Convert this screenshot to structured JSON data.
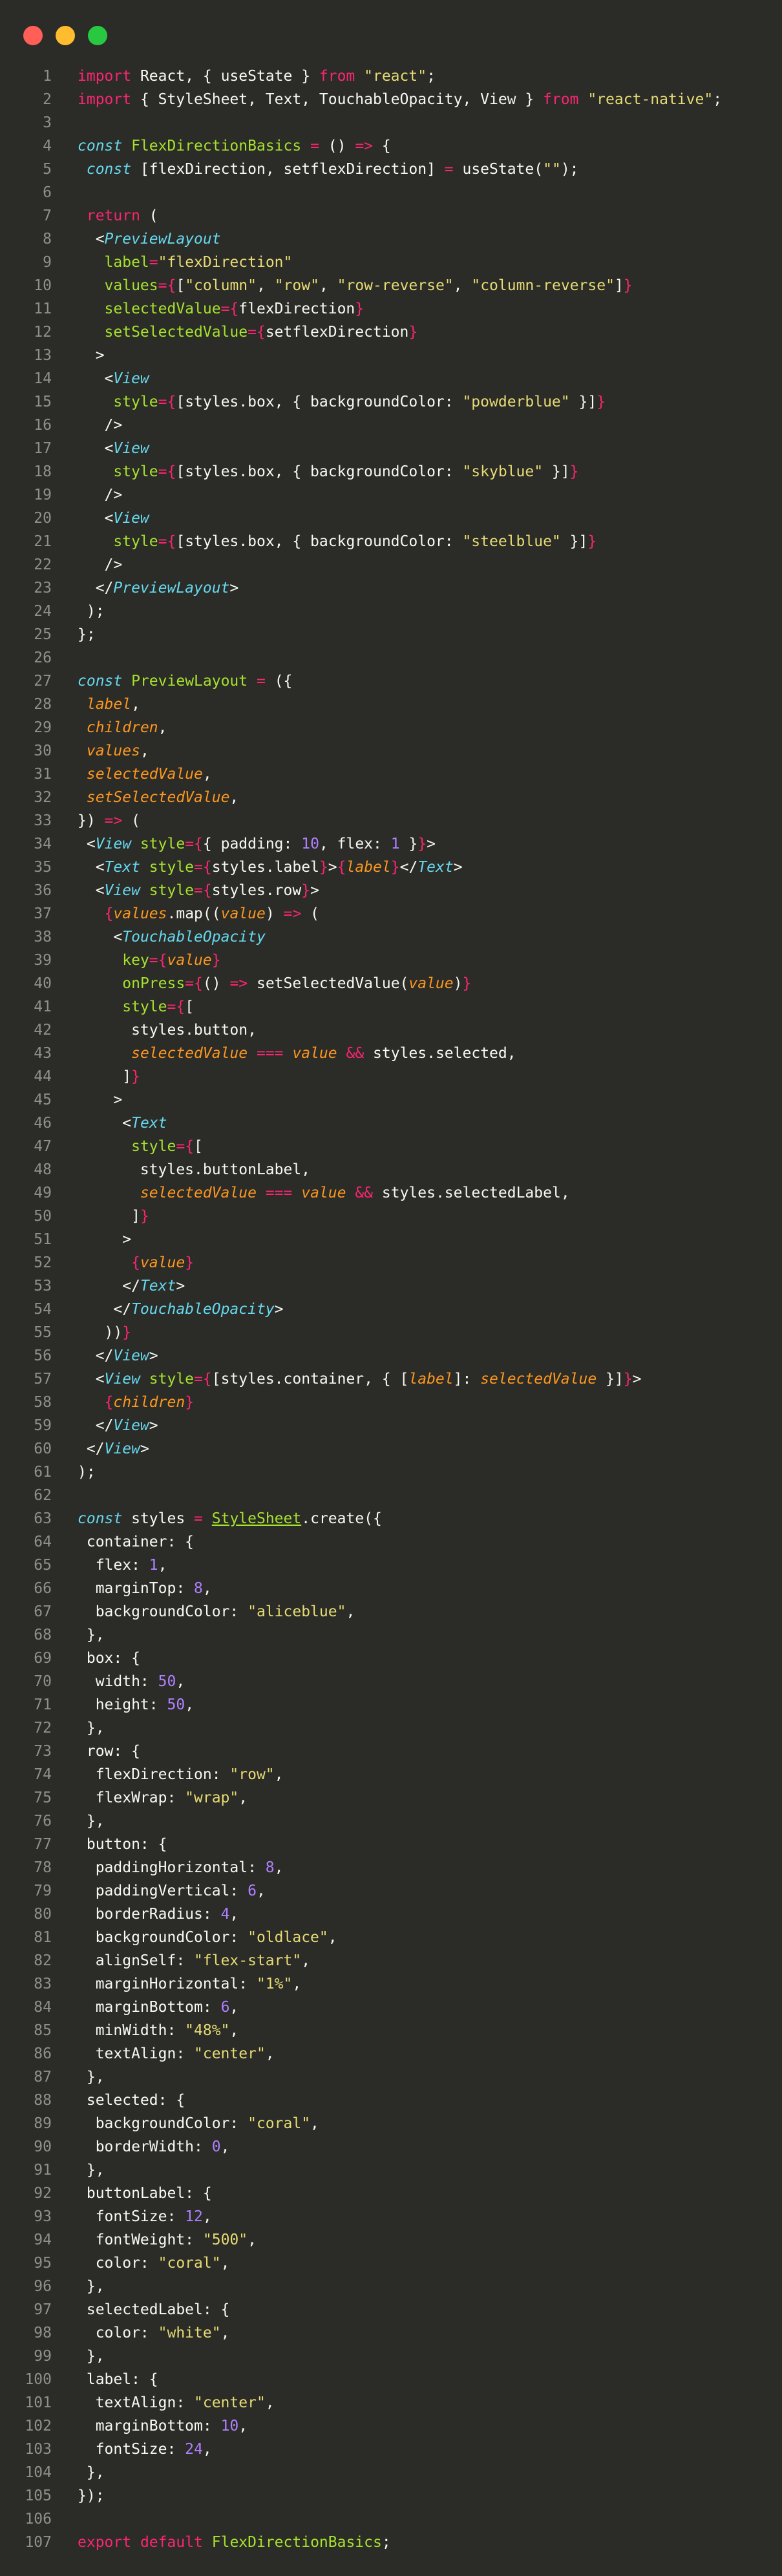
{
  "window": {
    "buttons": [
      {
        "name": "close",
        "color": "#ff5f57"
      },
      {
        "name": "minimize",
        "color": "#febc2e"
      },
      {
        "name": "maximize",
        "color": "#28c840"
      }
    ]
  },
  "theme": {
    "background": "#2b2b27",
    "keyword": "#f92672",
    "string": "#e6db74",
    "number": "#ae81ff",
    "component": "#66d9ef",
    "function": "#a6e22e",
    "param": "#fd971f"
  },
  "lines": [
    [
      [
        "k",
        "import"
      ],
      [
        "",
        "  React, { useState } "
      ],
      [
        "k",
        "from"
      ],
      [
        "",
        "  "
      ],
      [
        "s",
        "\"react\""
      ],
      [
        "",
        ";"
      ]
    ],
    [
      [
        "k",
        "import"
      ],
      [
        "",
        "  { StyleSheet, Text, TouchableOpacity, View } "
      ],
      [
        "k",
        "from"
      ],
      [
        "",
        "  "
      ],
      [
        "s",
        "\"react-native\""
      ],
      [
        "",
        ";"
      ]
    ],
    [],
    [
      [
        "c",
        "const"
      ],
      [
        "",
        "  "
      ],
      [
        "f",
        "FlexDirectionBasics"
      ],
      [
        "",
        "  "
      ],
      [
        "k",
        "="
      ],
      [
        "",
        "  () "
      ],
      [
        "k",
        "=>"
      ],
      [
        "",
        "  {"
      ]
    ],
    [
      [
        "",
        "  "
      ],
      [
        "c",
        "const"
      ],
      [
        "",
        "  [flexDirection, setflexDirection] "
      ],
      [
        "k",
        "="
      ],
      [
        "",
        "  useState("
      ],
      [
        "s",
        "\"\""
      ],
      [
        "",
        ");"
      ]
    ],
    [],
    [
      [
        "",
        "  "
      ],
      [
        "k",
        "return"
      ],
      [
        "",
        "  ("
      ]
    ],
    [
      [
        "",
        "    <"
      ],
      [
        "c",
        "PreviewLayout"
      ]
    ],
    [
      [
        "",
        "      "
      ],
      [
        "f",
        "label"
      ],
      [
        "k",
        "="
      ],
      [
        "s",
        "\"flexDirection\""
      ]
    ],
    [
      [
        "",
        "      "
      ],
      [
        "f",
        "values"
      ],
      [
        "k",
        "={"
      ],
      [
        "",
        "["
      ],
      [
        "s",
        "\"column\""
      ],
      [
        "",
        ", "
      ],
      [
        "s",
        "\"row\""
      ],
      [
        "",
        ", "
      ],
      [
        "s",
        "\"row-reverse\""
      ],
      [
        "",
        ", "
      ],
      [
        "s",
        "\"column-reverse\""
      ],
      [
        "",
        "]"
      ],
      [
        "k",
        "}"
      ]
    ],
    [
      [
        "",
        "      "
      ],
      [
        "f",
        "selectedValue"
      ],
      [
        "k",
        "={"
      ],
      [
        "",
        "flexDirection"
      ],
      [
        "k",
        "}"
      ]
    ],
    [
      [
        "",
        "      "
      ],
      [
        "f",
        "setSelectedValue"
      ],
      [
        "k",
        "={"
      ],
      [
        "",
        "setflexDirection"
      ],
      [
        "k",
        "}"
      ]
    ],
    [
      [
        "",
        "    >"
      ]
    ],
    [
      [
        "",
        "      <"
      ],
      [
        "c",
        "View"
      ]
    ],
    [
      [
        "",
        "        "
      ],
      [
        "f",
        "style"
      ],
      [
        "k",
        "={"
      ],
      [
        "",
        "[styles.box, { backgroundColor: "
      ],
      [
        "s",
        "\"powderblue\""
      ],
      [
        "",
        "  }]"
      ],
      [
        "k",
        "}"
      ]
    ],
    [
      [
        "",
        "      />"
      ]
    ],
    [
      [
        "",
        "      <"
      ],
      [
        "c",
        "View"
      ]
    ],
    [
      [
        "",
        "        "
      ],
      [
        "f",
        "style"
      ],
      [
        "k",
        "={"
      ],
      [
        "",
        "[styles.box, { backgroundColor: "
      ],
      [
        "s",
        "\"skyblue\""
      ],
      [
        "",
        "  }]"
      ],
      [
        "k",
        "}"
      ]
    ],
    [
      [
        "",
        "      />"
      ]
    ],
    [
      [
        "",
        "      <"
      ],
      [
        "c",
        "View"
      ]
    ],
    [
      [
        "",
        "        "
      ],
      [
        "f",
        "style"
      ],
      [
        "k",
        "={"
      ],
      [
        "",
        "[styles.box, { backgroundColor: "
      ],
      [
        "s",
        "\"steelblue\""
      ],
      [
        "",
        "  }]"
      ],
      [
        "k",
        "}"
      ]
    ],
    [
      [
        "",
        "      />"
      ]
    ],
    [
      [
        "",
        "    </"
      ],
      [
        "c",
        "PreviewLayout"
      ],
      [
        "",
        ">"
      ]
    ],
    [
      [
        "",
        "  );"
      ]
    ],
    [
      [
        "",
        "};"
      ]
    ],
    [],
    [
      [
        "c",
        "const"
      ],
      [
        "",
        "  "
      ],
      [
        "f",
        "PreviewLayout"
      ],
      [
        "",
        "  "
      ],
      [
        "k",
        "="
      ],
      [
        "",
        "  ({"
      ]
    ],
    [
      [
        "",
        "  "
      ],
      [
        "p",
        "label"
      ],
      [
        "",
        ","
      ]
    ],
    [
      [
        "",
        "  "
      ],
      [
        "p",
        "children"
      ],
      [
        "",
        ","
      ]
    ],
    [
      [
        "",
        "  "
      ],
      [
        "p",
        "values"
      ],
      [
        "",
        ","
      ]
    ],
    [
      [
        "",
        "  "
      ],
      [
        "p",
        "selectedValue"
      ],
      [
        "",
        ","
      ]
    ],
    [
      [
        "",
        "  "
      ],
      [
        "p",
        "setSelectedValue"
      ],
      [
        "",
        ","
      ]
    ],
    [
      [
        "",
        "}) "
      ],
      [
        "k",
        "=>"
      ],
      [
        "",
        "  ("
      ]
    ],
    [
      [
        "",
        "  <"
      ],
      [
        "c",
        "View"
      ],
      [
        "",
        "  "
      ],
      [
        "f",
        "style"
      ],
      [
        "k",
        "={"
      ],
      [
        "",
        "{ padding: "
      ],
      [
        "n",
        "10"
      ],
      [
        "",
        ", flex: "
      ],
      [
        "n",
        "1"
      ],
      [
        "",
        "  }"
      ],
      [
        "k",
        "}"
      ],
      [
        "",
        ">"
      ]
    ],
    [
      [
        "",
        "    <"
      ],
      [
        "c",
        "Text"
      ],
      [
        "",
        "  "
      ],
      [
        "f",
        "style"
      ],
      [
        "k",
        "={"
      ],
      [
        "",
        "styles.label"
      ],
      [
        "k",
        "}"
      ],
      [
        "",
        ">"
      ],
      [
        "k",
        "{"
      ],
      [
        "p",
        "label"
      ],
      [
        "k",
        "}"
      ],
      [
        "",
        "</"
      ],
      [
        "c",
        "Text"
      ],
      [
        "",
        ">"
      ]
    ],
    [
      [
        "",
        "    <"
      ],
      [
        "c",
        "View"
      ],
      [
        "",
        "  "
      ],
      [
        "f",
        "style"
      ],
      [
        "k",
        "={"
      ],
      [
        "",
        "styles.row"
      ],
      [
        "k",
        "}"
      ],
      [
        "",
        ">"
      ]
    ],
    [
      [
        "",
        "      "
      ],
      [
        "k",
        "{"
      ],
      [
        "p",
        "values"
      ],
      [
        "",
        ".map(("
      ],
      [
        "p",
        "value"
      ],
      [
        "",
        ") "
      ],
      [
        "k",
        "=>"
      ],
      [
        "",
        "  ("
      ]
    ],
    [
      [
        "",
        "        <"
      ],
      [
        "c",
        "TouchableOpacity"
      ]
    ],
    [
      [
        "",
        "          "
      ],
      [
        "f",
        "key"
      ],
      [
        "k",
        "={"
      ],
      [
        "p",
        "value"
      ],
      [
        "k",
        "}"
      ]
    ],
    [
      [
        "",
        "          "
      ],
      [
        "f",
        "onPress"
      ],
      [
        "k",
        "={"
      ],
      [
        "",
        "() "
      ],
      [
        "k",
        "=>"
      ],
      [
        "",
        "  setSelectedValue("
      ],
      [
        "p",
        "value"
      ],
      [
        "",
        ")"
      ],
      [
        "k",
        "}"
      ]
    ],
    [
      [
        "",
        "          "
      ],
      [
        "f",
        "style"
      ],
      [
        "k",
        "={"
      ],
      [
        "",
        "["
      ]
    ],
    [
      [
        "",
        "            styles.button,"
      ]
    ],
    [
      [
        "",
        "            "
      ],
      [
        "p",
        "selectedValue"
      ],
      [
        "",
        "  "
      ],
      [
        "k",
        "==="
      ],
      [
        "",
        "  "
      ],
      [
        "p",
        "value"
      ],
      [
        "",
        "  "
      ],
      [
        "k",
        "&&"
      ],
      [
        "",
        "  styles.selected,"
      ]
    ],
    [
      [
        "",
        "          ]"
      ],
      [
        "k",
        "}"
      ]
    ],
    [
      [
        "",
        "        >"
      ]
    ],
    [
      [
        "",
        "          <"
      ],
      [
        "c",
        "Text"
      ]
    ],
    [
      [
        "",
        "            "
      ],
      [
        "f",
        "style"
      ],
      [
        "k",
        "={"
      ],
      [
        "",
        "["
      ]
    ],
    [
      [
        "",
        "              styles.buttonLabel,"
      ]
    ],
    [
      [
        "",
        "              "
      ],
      [
        "p",
        "selectedValue"
      ],
      [
        "",
        "  "
      ],
      [
        "k",
        "==="
      ],
      [
        "",
        "  "
      ],
      [
        "p",
        "value"
      ],
      [
        "",
        "  "
      ],
      [
        "k",
        "&&"
      ],
      [
        "",
        "  styles.selectedLabel,"
      ]
    ],
    [
      [
        "",
        "            ]"
      ],
      [
        "k",
        "}"
      ]
    ],
    [
      [
        "",
        "          >"
      ]
    ],
    [
      [
        "",
        "            "
      ],
      [
        "k",
        "{"
      ],
      [
        "p",
        "value"
      ],
      [
        "k",
        "}"
      ]
    ],
    [
      [
        "",
        "          </"
      ],
      [
        "c",
        "Text"
      ],
      [
        "",
        ">"
      ]
    ],
    [
      [
        "",
        "        </"
      ],
      [
        "c",
        "TouchableOpacity"
      ],
      [
        "",
        ">"
      ]
    ],
    [
      [
        "",
        "      ))"
      ],
      [
        "k",
        "}"
      ]
    ],
    [
      [
        "",
        "    </"
      ],
      [
        "c",
        "View"
      ],
      [
        "",
        ">"
      ]
    ],
    [
      [
        "",
        "    <"
      ],
      [
        "c",
        "View"
      ],
      [
        "",
        "  "
      ],
      [
        "f",
        "style"
      ],
      [
        "k",
        "={"
      ],
      [
        "",
        "[styles.container, { ["
      ],
      [
        "p",
        "label"
      ],
      [
        "",
        "]: "
      ],
      [
        "p",
        "selectedValue"
      ],
      [
        "",
        "  }]"
      ],
      [
        "k",
        "}"
      ],
      [
        "",
        ">"
      ]
    ],
    [
      [
        "",
        "      "
      ],
      [
        "k",
        "{"
      ],
      [
        "p",
        "children"
      ],
      [
        "k",
        "}"
      ]
    ],
    [
      [
        "",
        "    </"
      ],
      [
        "c",
        "View"
      ],
      [
        "",
        ">"
      ]
    ],
    [
      [
        "",
        "  </"
      ],
      [
        "c",
        "View"
      ],
      [
        "",
        ">"
      ]
    ],
    [
      [
        "",
        ");"
      ]
    ],
    [],
    [
      [
        "c",
        "const"
      ],
      [
        "",
        "  styles "
      ],
      [
        "k",
        "="
      ],
      [
        "",
        "  "
      ],
      [
        "fu",
        "StyleSheet"
      ],
      [
        "",
        ".create({"
      ]
    ],
    [
      [
        "",
        "  container: {"
      ]
    ],
    [
      [
        "",
        "    flex: "
      ],
      [
        "n",
        "1"
      ],
      [
        "",
        ","
      ]
    ],
    [
      [
        "",
        "    marginTop: "
      ],
      [
        "n",
        "8"
      ],
      [
        "",
        ","
      ]
    ],
    [
      [
        "",
        "    backgroundColor: "
      ],
      [
        "s",
        "\"aliceblue\""
      ],
      [
        "",
        ","
      ]
    ],
    [
      [
        "",
        "  },"
      ]
    ],
    [
      [
        "",
        "  box: {"
      ]
    ],
    [
      [
        "",
        "    width: "
      ],
      [
        "n",
        "50"
      ],
      [
        "",
        ","
      ]
    ],
    [
      [
        "",
        "    height: "
      ],
      [
        "n",
        "50"
      ],
      [
        "",
        ","
      ]
    ],
    [
      [
        "",
        "  },"
      ]
    ],
    [
      [
        "",
        "  row: {"
      ]
    ],
    [
      [
        "",
        "    flexDirection: "
      ],
      [
        "s",
        "\"row\""
      ],
      [
        "",
        ","
      ]
    ],
    [
      [
        "",
        "    flexWrap: "
      ],
      [
        "s",
        "\"wrap\""
      ],
      [
        "",
        ","
      ]
    ],
    [
      [
        "",
        "  },"
      ]
    ],
    [
      [
        "",
        "  button: {"
      ]
    ],
    [
      [
        "",
        "    paddingHorizontal: "
      ],
      [
        "n",
        "8"
      ],
      [
        "",
        ","
      ]
    ],
    [
      [
        "",
        "    paddingVertical: "
      ],
      [
        "n",
        "6"
      ],
      [
        "",
        ","
      ]
    ],
    [
      [
        "",
        "    borderRadius: "
      ],
      [
        "n",
        "4"
      ],
      [
        "",
        ","
      ]
    ],
    [
      [
        "",
        "    backgroundColor: "
      ],
      [
        "s",
        "\"oldlace\""
      ],
      [
        "",
        ","
      ]
    ],
    [
      [
        "",
        "    alignSelf: "
      ],
      [
        "s",
        "\"flex-start\""
      ],
      [
        "",
        ","
      ]
    ],
    [
      [
        "",
        "    marginHorizontal: "
      ],
      [
        "s",
        "\"1%\""
      ],
      [
        "",
        ","
      ]
    ],
    [
      [
        "",
        "    marginBottom: "
      ],
      [
        "n",
        "6"
      ],
      [
        "",
        ","
      ]
    ],
    [
      [
        "",
        "    minWidth: "
      ],
      [
        "s",
        "\"48%\""
      ],
      [
        "",
        ","
      ]
    ],
    [
      [
        "",
        "    textAlign: "
      ],
      [
        "s",
        "\"center\""
      ],
      [
        "",
        ","
      ]
    ],
    [
      [
        "",
        "  },"
      ]
    ],
    [
      [
        "",
        "  selected: {"
      ]
    ],
    [
      [
        "",
        "    backgroundColor: "
      ],
      [
        "s",
        "\"coral\""
      ],
      [
        "",
        ","
      ]
    ],
    [
      [
        "",
        "    borderWidth: "
      ],
      [
        "n",
        "0"
      ],
      [
        "",
        ","
      ]
    ],
    [
      [
        "",
        "  },"
      ]
    ],
    [
      [
        "",
        "  buttonLabel: {"
      ]
    ],
    [
      [
        "",
        "    fontSize: "
      ],
      [
        "n",
        "12"
      ],
      [
        "",
        ","
      ]
    ],
    [
      [
        "",
        "    fontWeight: "
      ],
      [
        "s",
        "\"500\""
      ],
      [
        "",
        ","
      ]
    ],
    [
      [
        "",
        "    color: "
      ],
      [
        "s",
        "\"coral\""
      ],
      [
        "",
        ","
      ]
    ],
    [
      [
        "",
        "  },"
      ]
    ],
    [
      [
        "",
        "  selectedLabel: {"
      ]
    ],
    [
      [
        "",
        "    color: "
      ],
      [
        "s",
        "\"white\""
      ],
      [
        "",
        ","
      ]
    ],
    [
      [
        "",
        "  },"
      ]
    ],
    [
      [
        "",
        "  label: {"
      ]
    ],
    [
      [
        "",
        "    textAlign: "
      ],
      [
        "s",
        "\"center\""
      ],
      [
        "",
        ","
      ]
    ],
    [
      [
        "",
        "    marginBottom: "
      ],
      [
        "n",
        "10"
      ],
      [
        "",
        ","
      ]
    ],
    [
      [
        "",
        "    fontSize: "
      ],
      [
        "n",
        "24"
      ],
      [
        "",
        ","
      ]
    ],
    [
      [
        "",
        "  },"
      ]
    ],
    [
      [
        "",
        "});"
      ]
    ],
    [],
    [
      [
        "k",
        "export"
      ],
      [
        "",
        "  "
      ],
      [
        "k",
        "default"
      ],
      [
        "",
        "  "
      ],
      [
        "f",
        "FlexDirectionBasics"
      ],
      [
        "",
        ";"
      ]
    ]
  ]
}
